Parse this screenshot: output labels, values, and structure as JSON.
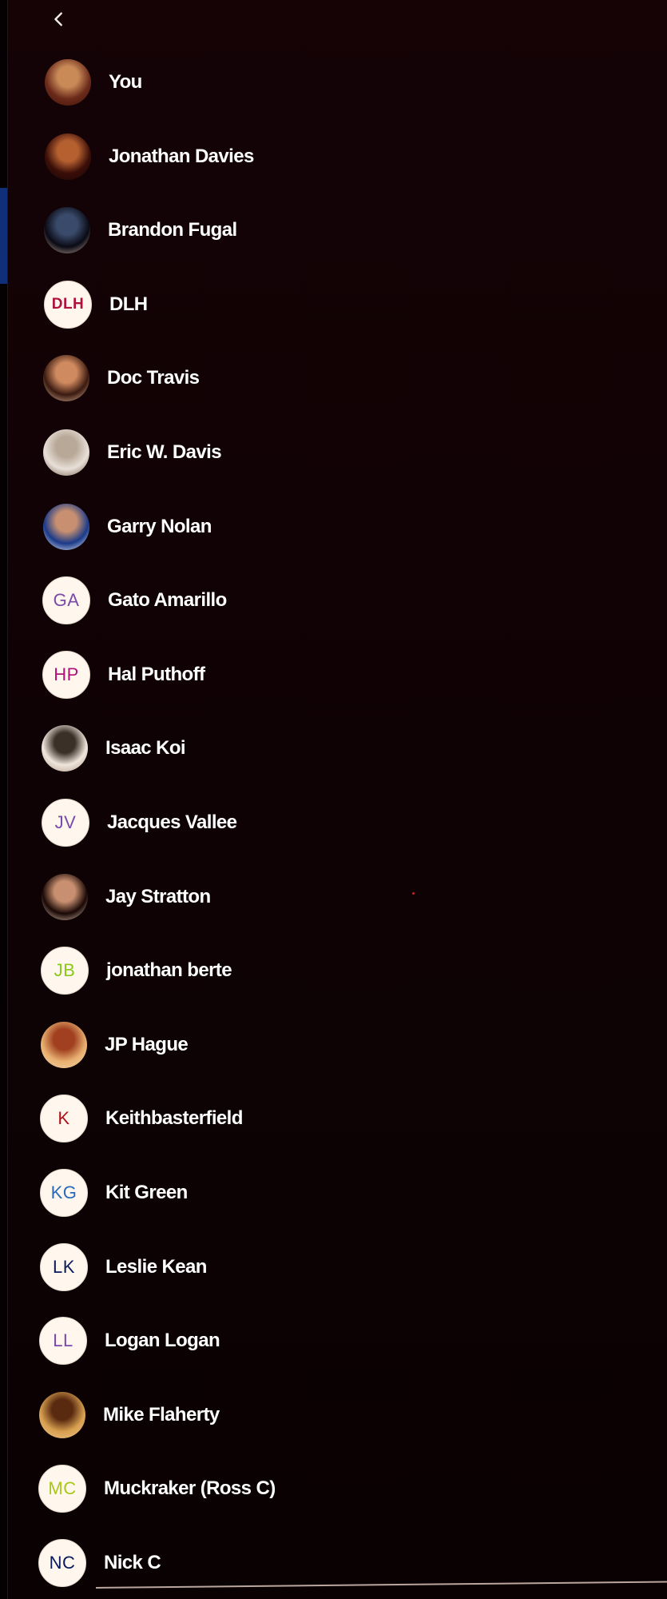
{
  "colors": {
    "background": "#0e0205",
    "text": "#ffffff",
    "initials_bg": "#fff6ee",
    "left_accent": "#0f2f78"
  },
  "back_icon": "chevron-left-icon",
  "participants": [
    {
      "name": "You",
      "avatar": {
        "type": "photo",
        "colors": [
          "#6b2a1a",
          "#c98a58",
          "#3a1208"
        ]
      }
    },
    {
      "name": "Jonathan Davies",
      "avatar": {
        "type": "photo",
        "colors": [
          "#3a0e08",
          "#b66030",
          "#1a0504"
        ]
      }
    },
    {
      "name": "Brandon Fugal",
      "avatar": {
        "type": "photo",
        "colors": [
          "#0a0a14",
          "#3a4a6a",
          "#c8b0a0"
        ]
      }
    },
    {
      "name": "DLH",
      "avatar": {
        "type": "initials",
        "text": "DLH",
        "color": "#b0123e"
      }
    },
    {
      "name": "Doc Travis",
      "avatar": {
        "type": "photo",
        "colors": [
          "#3a1a10",
          "#d08a60",
          "#e8c0a0"
        ]
      }
    },
    {
      "name": "Eric W. Davis",
      "avatar": {
        "type": "photo",
        "colors": [
          "#e8e0d8",
          "#b8a898",
          "#6a5040"
        ]
      }
    },
    {
      "name": "Garry Nolan",
      "avatar": {
        "type": "photo",
        "colors": [
          "#1a3a8a",
          "#c89070",
          "#ffffff"
        ]
      }
    },
    {
      "name": "Gato Amarillo",
      "avatar": {
        "type": "initials",
        "text": "GA",
        "color": "#7a4aa8"
      }
    },
    {
      "name": "Hal Puthoff",
      "avatar": {
        "type": "initials",
        "text": "HP",
        "color": "#b0127a"
      }
    },
    {
      "name": "Isaac Koi",
      "avatar": {
        "type": "photo",
        "colors": [
          "#f0e6dc",
          "#3a3028",
          "#a89080"
        ]
      }
    },
    {
      "name": "Jacques Vallee",
      "avatar": {
        "type": "initials",
        "text": "JV",
        "color": "#7a4aa8"
      }
    },
    {
      "name": "Jay Stratton",
      "avatar": {
        "type": "photo",
        "colors": [
          "#1a0806",
          "#c89070",
          "#e8d0b8"
        ]
      }
    },
    {
      "name": "jonathan berte",
      "avatar": {
        "type": "initials",
        "text": "JB",
        "color": "#8ac81a"
      }
    },
    {
      "name": "JP Hague",
      "avatar": {
        "type": "photo",
        "colors": [
          "#e8b070",
          "#a04020",
          "#f0d8b0"
        ]
      }
    },
    {
      "name": "Keithbasterfield",
      "avatar": {
        "type": "initials",
        "text": "K",
        "color": "#b01218"
      }
    },
    {
      "name": "Kit Green",
      "avatar": {
        "type": "initials",
        "text": "KG",
        "color": "#2a6ab8"
      }
    },
    {
      "name": "Leslie Kean",
      "avatar": {
        "type": "initials",
        "text": "LK",
        "color": "#0a1a5a"
      }
    },
    {
      "name": "Logan Logan",
      "avatar": {
        "type": "initials",
        "text": "LL",
        "color": "#7a4aa8"
      }
    },
    {
      "name": "Mike Flaherty",
      "avatar": {
        "type": "photo",
        "colors": [
          "#d8a050",
          "#5a2a10",
          "#f0c890"
        ]
      }
    },
    {
      "name": "Muckraker (Ross C)",
      "avatar": {
        "type": "initials",
        "text": "MC",
        "color": "#a8c81a"
      }
    },
    {
      "name": "Nick C",
      "avatar": {
        "type": "initials",
        "text": "NC",
        "color": "#0a1a5a"
      }
    }
  ]
}
